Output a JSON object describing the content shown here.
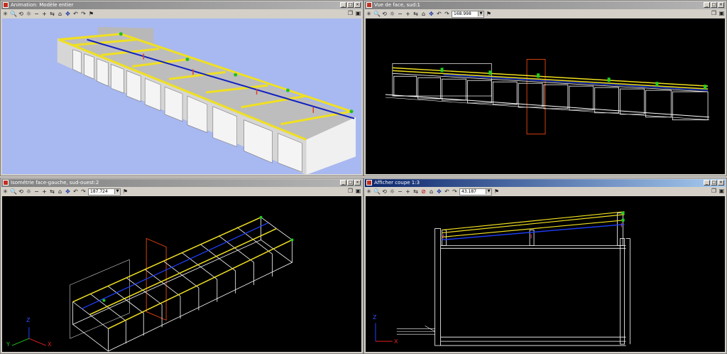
{
  "windows": [
    {
      "title": "Animation: Modèle entier",
      "zoom": null
    },
    {
      "title": "Vue de face, sud:1",
      "zoom": "168.998"
    },
    {
      "title": "Isométrie face-gauche, sud-ouest:2",
      "zoom": "187.724"
    },
    {
      "title": "Afficher coupe 1:3",
      "zoom": "43.187"
    }
  ],
  "window_controls": {
    "minimize": "_",
    "maximize": "□",
    "close": "×"
  },
  "toolbar": {
    "asterisk": "✳",
    "zoom": "🔍",
    "rotate": "⟲",
    "sun": "☼",
    "minus": "−",
    "plus": "+",
    "pan_arrows": "⇆",
    "home": "⌂",
    "pan": "✥",
    "undo": "↶",
    "redo": "↷",
    "flag": "⚑",
    "section": "⊘"
  },
  "right_tools": {
    "window_icon": "❐",
    "layout_icon": "▣"
  },
  "axes": {
    "x": "X",
    "y": "Y",
    "z": "Z"
  },
  "colors": {
    "model_bg": "#a8b8f0",
    "view_bg": "#000000",
    "active_title": "#0a246a",
    "inactive_title": "#808080"
  }
}
